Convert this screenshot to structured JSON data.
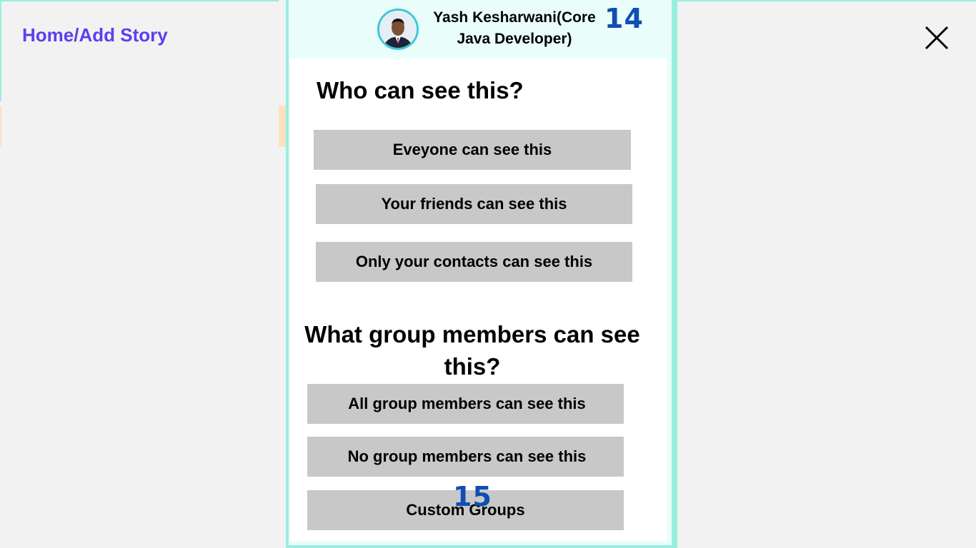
{
  "sidebar": {
    "breadcrumb": "Home/Add Story"
  },
  "profile": {
    "name": "Yash Kesharwani(Core Java Developer)",
    "avatar_icon": "user-avatar-icon"
  },
  "step_badges": {
    "header": "14",
    "options": "15"
  },
  "visibility": {
    "title": "Who can see this?",
    "options": [
      "Eveyone can see this",
      "Your friends can see this",
      "Only your contacts can see this"
    ]
  },
  "group_visibility": {
    "title": "What group members can see this?",
    "options": [
      "All group members can see this",
      "No group members can see this",
      "Custom Groups"
    ]
  },
  "close": {
    "icon": "close-icon"
  },
  "colors": {
    "accent_purple": "#5b3ff0",
    "teal_band": "#97efe0",
    "step_blue": "#0f4fb3",
    "button_gray": "#c8c8c8"
  }
}
